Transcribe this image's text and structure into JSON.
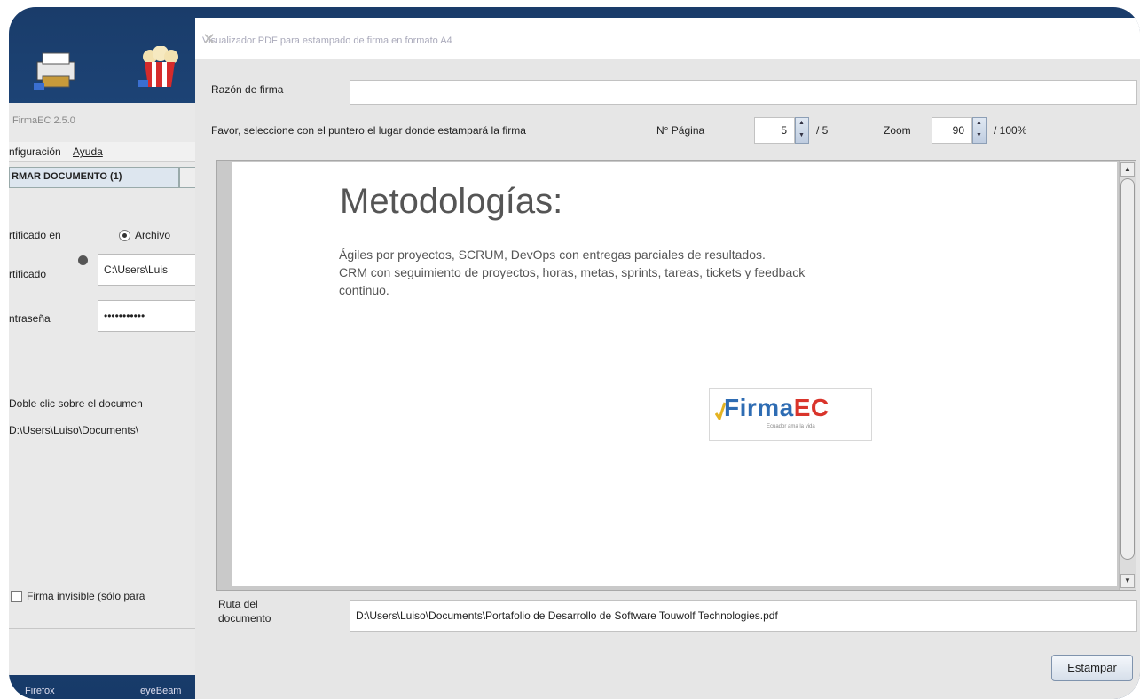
{
  "background_app": {
    "title": "FirmaEC 2.5.0",
    "menu": [
      "nfiguración",
      "Ayuda"
    ],
    "tab_label": "RMAR DOCUMENTO (1)",
    "cert_in_label": "rtificado en",
    "radio_file": "Archivo",
    "cert_label": "rtificado",
    "cert_value": "C:\\Users\\Luis",
    "password_label": "ntraseña",
    "password_value": "•••••••••••",
    "hint": "Doble clic sobre el documen",
    "path": "D:\\Users\\Luiso\\Documents\\",
    "invisible_label": "Firma invisible (sólo para"
  },
  "taskbar": [
    "Firefox",
    "eyeBeam"
  ],
  "dialog": {
    "title": "Visualizador PDF para estampado de firma en formato A4",
    "reason_label": "Razón de firma",
    "reason_value": "",
    "instruction": "Favor, seleccione con el puntero el lugar donde estampará la firma",
    "page_label": "N° Página",
    "page_value": "5",
    "page_total": "/ 5",
    "zoom_label": "Zoom",
    "zoom_value": "90",
    "zoom_max": "/ 100%",
    "path_label_1": "Ruta del",
    "path_label_2": "documento",
    "path_value": "D:\\Users\\Luiso\\Documents\\Portafolio de Desarrollo de Software Touwolf Technologies.pdf",
    "stamp_button": "Estampar"
  },
  "document": {
    "heading": "Metodologías:",
    "line1": "Ágiles por proyectos, SCRUM, DevOps con entregas parciales de resultados.",
    "line2": "CRM con seguimiento de proyectos, horas, metas, sprints, tareas, tickets y feedback",
    "line3": "continuo.",
    "logo_a": "Firma",
    "logo_b": "EC",
    "logo_tag": "Ecuador ama la vida"
  },
  "colors": {
    "logo_blue": "#2e6cb3",
    "logo_red": "#d9342b",
    "desktop": "#20508a"
  }
}
